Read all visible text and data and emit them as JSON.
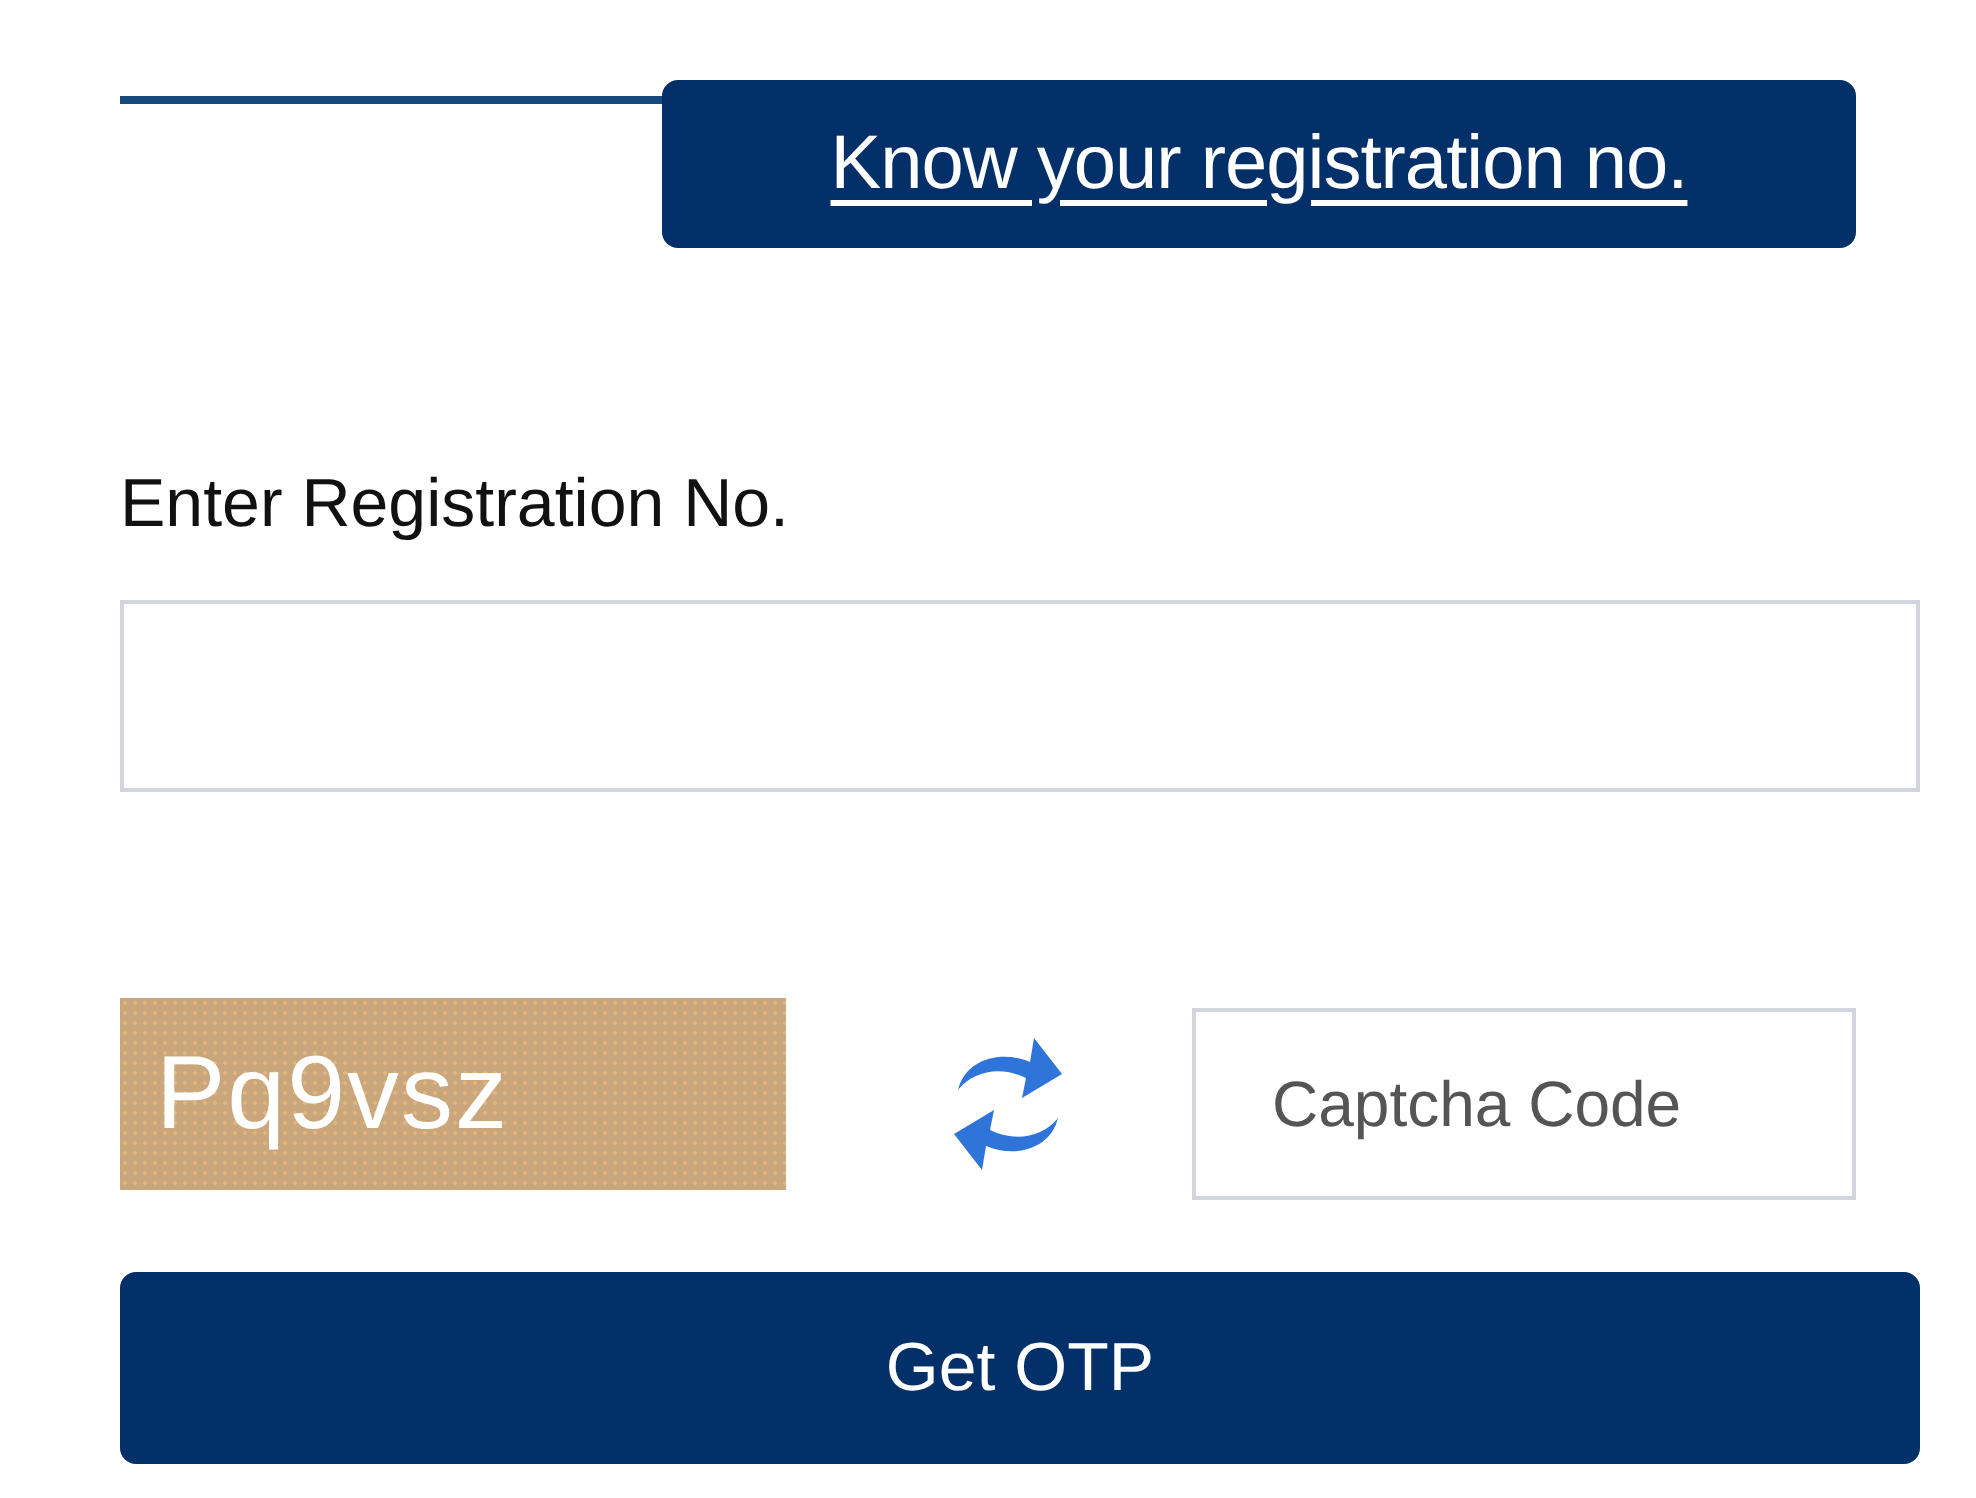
{
  "link_button": {
    "label": "Know your registration no."
  },
  "registration": {
    "label": "Enter Registration No."
  },
  "captcha": {
    "code": "Pq9vsz",
    "placeholder": "Captcha Code"
  },
  "submit": {
    "label": "Get OTP"
  }
}
